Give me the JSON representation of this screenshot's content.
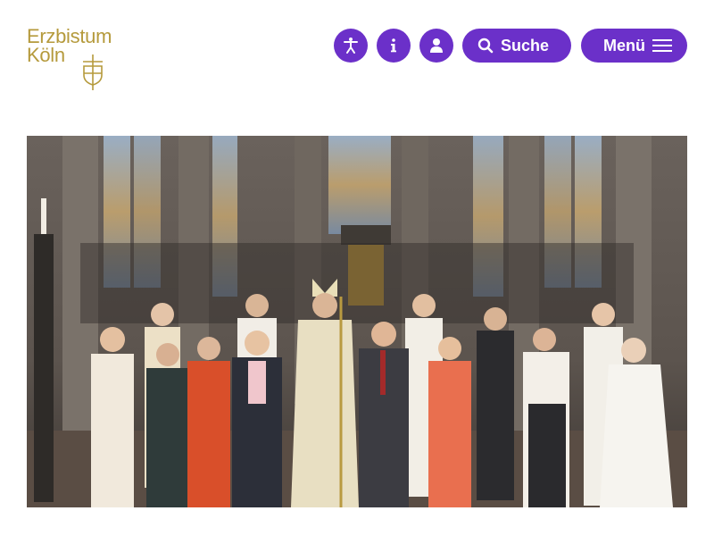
{
  "brand": {
    "name_line1": "Erzbistum",
    "name_line2": "Köln",
    "color": "#b59a3c"
  },
  "nav": {
    "accent": "#6b30c9",
    "accessibility_icon": "accessibility-icon",
    "info_icon": "info-icon",
    "user_icon": "user-icon",
    "search_label": "Suche",
    "search_icon": "search-icon",
    "menu_label": "Menü",
    "menu_icon": "hamburger-icon"
  },
  "hero": {
    "image": "group-photo-in-cathedral"
  }
}
